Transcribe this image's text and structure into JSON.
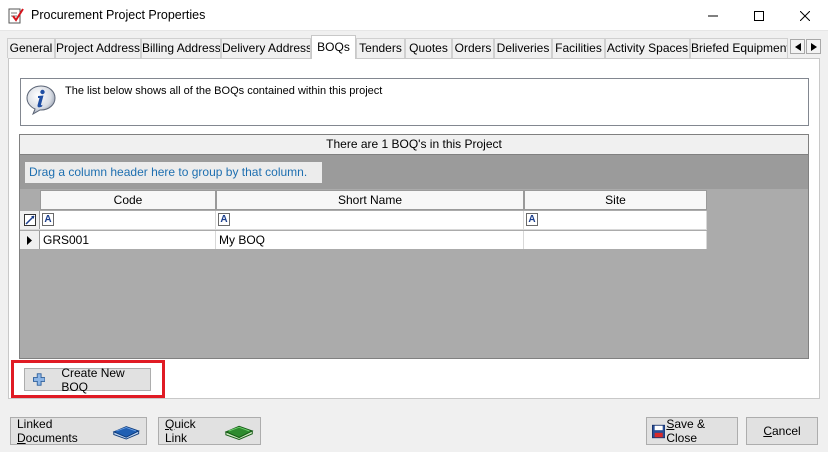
{
  "window": {
    "title": "Procurement Project Properties"
  },
  "tabs": [
    {
      "label": "General"
    },
    {
      "label": "Project Address"
    },
    {
      "label": "Billing Address"
    },
    {
      "label": "Delivery Address"
    },
    {
      "label": "BOQs",
      "active": true
    },
    {
      "label": "Tenders"
    },
    {
      "label": "Quotes"
    },
    {
      "label": "Orders"
    },
    {
      "label": "Deliveries"
    },
    {
      "label": "Facilities"
    },
    {
      "label": "Activity Spaces"
    },
    {
      "label": "Briefed Equipment"
    }
  ],
  "info": {
    "icon": "info-icon",
    "text": "The list below shows all of the BOQs contained within this project"
  },
  "grid": {
    "caption": "There are 1 BOQ's in this Project",
    "group_hint": "Drag a column header here to group by that column.",
    "columns": [
      {
        "label": "Code"
      },
      {
        "label": "Short Name"
      },
      {
        "label": "Site"
      }
    ],
    "rows": [
      {
        "code": "GRS001",
        "short_name": "My BOQ",
        "site": ""
      }
    ],
    "filter_glyph": "A"
  },
  "buttons": {
    "create_pre": "",
    "create": "Create New BOQ",
    "linked_pre": "Linked ",
    "linked_u": "D",
    "linked_post": "ocuments",
    "quick_pre": "",
    "quick_u": "Q",
    "quick_post": "uick Link",
    "save_pre": "",
    "save_u": "S",
    "save_post": "ave & Close",
    "cancel_u": "C",
    "cancel_post": "ancel"
  },
  "colors": {
    "highlight": "#e01b24",
    "link_blue": "#1e6fb0"
  }
}
